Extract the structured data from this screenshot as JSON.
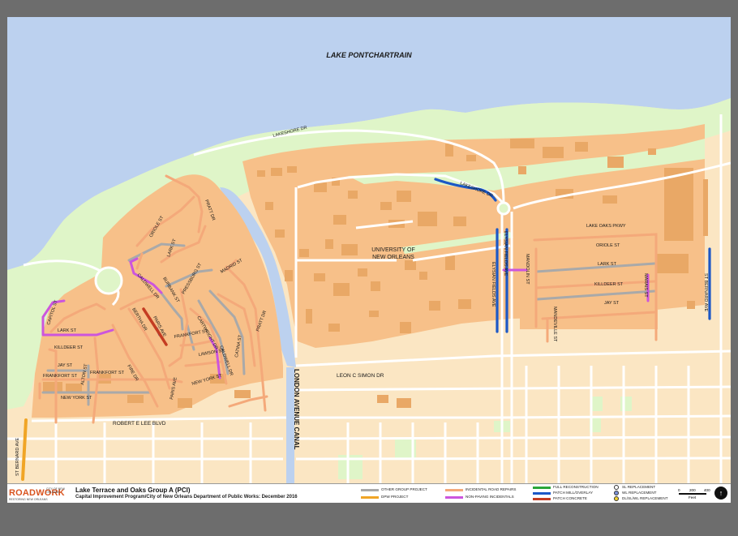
{
  "colors": {
    "water": "#bcd1ef",
    "green_space": "#dff5c8",
    "urban_land": "#fbe6c3",
    "neighborhood_land": "#f7c089",
    "buildings": "#e9a866",
    "streets": "#ffffff",
    "incidental_road_repairs": "#f4a97a",
    "other_group_project": "#a9a9a9",
    "non_paving_incidentals": "#cc55dd",
    "patch_mill_overlay": "#1c58c6",
    "patch_concrete": "#c43c22",
    "dpw_project": "#f0a526",
    "full_reconstruction": "#2aa63a",
    "background": "#6d6d6d"
  },
  "map": {
    "water_label": "LAKE PONTCHARTRAIN",
    "campus_label_line1": "UNIVERSITY OF",
    "campus_label_line2": "NEW ORLEANS",
    "canal_label": "LONDON AVENUE CANAL",
    "streets": {
      "lakeshore_dr": "LAKESHORE DR",
      "lakeshore_dr_2": "LAKESHORE DR",
      "leon_c_simon": "LEON C SIMON DR",
      "robert_e_lee": "ROBERT E LEE BLVD",
      "lake_oaks_pkwy": "LAKE OAKS PKWY",
      "oriole_st_east": "ORIOLE ST",
      "lark_st_east": "LARK ST",
      "killdeer_st_east": "KILLDEER ST",
      "jay_st_east": "JAY ST",
      "elysian_fields_1": "ELYSIAN FIELDS AVE",
      "elysian_fields_2": "ELYSIAN FIELDS AVE",
      "mandolin_st": "MANDOLIN ST",
      "mandeville_st": "MANDEVILLE ST",
      "marais_st": "MARAIS ST",
      "st_bernard_ave": "ST BERNARD AVE",
      "pratt_dr_1": "PRATT DR",
      "pratt_dr_2": "PRATT DR",
      "oriole_st_west": "ORIOLE ST",
      "lark_st_west": "LARK ST",
      "killdeer_st_west": "KILLDEER ST",
      "jay_st_west": "JAY ST",
      "frankfort_st": "FRANKFORT ST",
      "frankfort_st_2": "FRANKFORT ST",
      "frankfort_st_3": "FRANKFORT ST",
      "new_york_st": "NEW YORK ST",
      "new_york_st_2": "NEW YORK ST",
      "caldwell_dr": "CALDWELL DR",
      "caldwell_dr_2": "CALDWELL DR",
      "paris_ave": "PARIS AVE",
      "paris_ave_2": "PARIS AVE",
      "fire_dr": "FIRE DR",
      "lawson_st": "LAWSON ST",
      "madrid_st": "MADRID ST",
      "catina_st": "CATINA ST",
      "capitol_st": "CAPITOL ST",
      "bertha_dr": "BERTHA DR",
      "cartwright_dr": "CARTWRIGHT DR",
      "burbank_st": "BURBANK ST",
      "pressburg_st": "PRESSBURG ST",
      "alton_st": "ALTON ST"
    }
  },
  "legend": {
    "logo_word": "ROADWORK",
    "logo_city": "CITY OF NEW ORLEANS",
    "logo_sub": "RESTORING NEW ORLEANS",
    "title": "Lake Terrace and Oaks Group A (PCI)",
    "subtitle": "Capital Improvement Program/City of New Orleans Department of Public Works:  December 2016",
    "items": {
      "other_group_project": "OTHER GROUP PROJECT",
      "dpw_project": "DPW PROJECT",
      "incidental_road_repairs": "INCIDENTAL ROAD REPAIRS",
      "non_paving_incidentals": "NON-PAVING INCIDENTALS",
      "full_reconstruction": "FULL RECONSTRUCTION",
      "patch_mill_overlay": "PATCH MILL/OVERLAY",
      "patch_concrete": "PATCH CONCRETE",
      "sl_replacement": "SL REPLACEMENT",
      "wl_replacement": "WL REPLACEMENT",
      "dl_sl_wl_replacement": "DL/SL/WL REPLACEMENT"
    },
    "scale_ticks": [
      "0",
      "200",
      "400"
    ],
    "scale_unit": "Feet",
    "north_icon": "north-arrow-icon"
  }
}
